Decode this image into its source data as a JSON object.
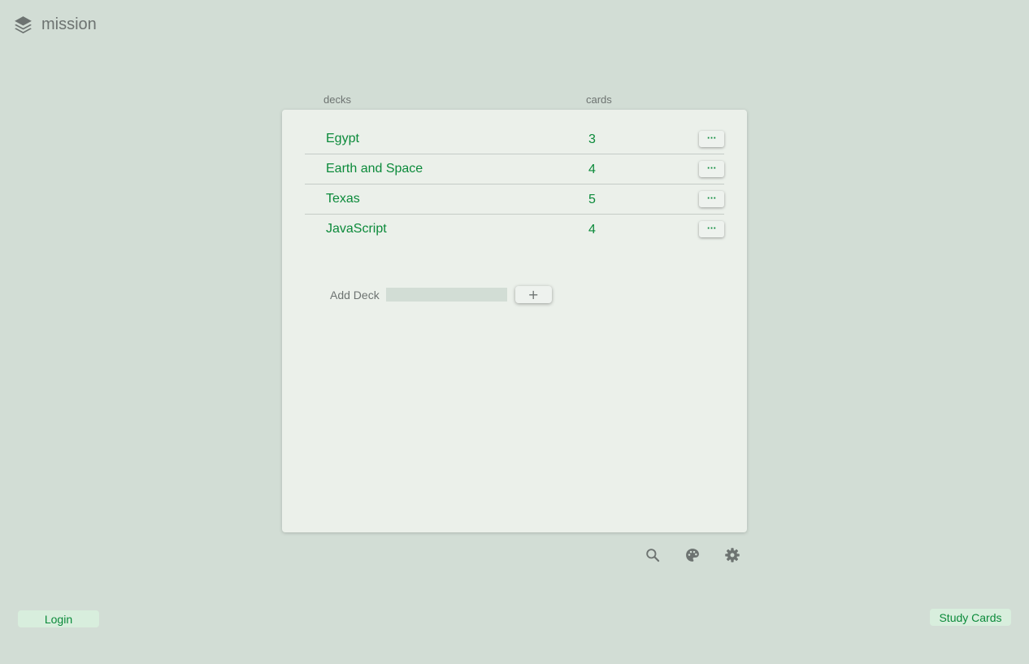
{
  "app": {
    "name": "mission",
    "logo_icon": "layers-icon"
  },
  "columns": {
    "decks": "decks",
    "cards": "cards"
  },
  "decks": [
    {
      "name": "Egypt",
      "cards": "3",
      "menu_label": "···"
    },
    {
      "name": "Earth and Space",
      "cards": "4",
      "menu_label": "···"
    },
    {
      "name": "Texas",
      "cards": "5",
      "menu_label": "···"
    },
    {
      "name": "JavaScript",
      "cards": "4",
      "menu_label": "···"
    }
  ],
  "add_deck": {
    "label": "Add Deck",
    "value": "",
    "button_label": "+"
  },
  "toolbar": {
    "icons": [
      "search-icon",
      "palette-icon",
      "gear-icon"
    ]
  },
  "footer": {
    "login_label": "Login",
    "study_label": "Study Cards"
  },
  "colors": {
    "background": "#d2ddd5",
    "panel": "#ebf0ea",
    "accent": "#0b8a3a",
    "muted_text": "#6d7371",
    "footer_button": "#d8eedd"
  }
}
